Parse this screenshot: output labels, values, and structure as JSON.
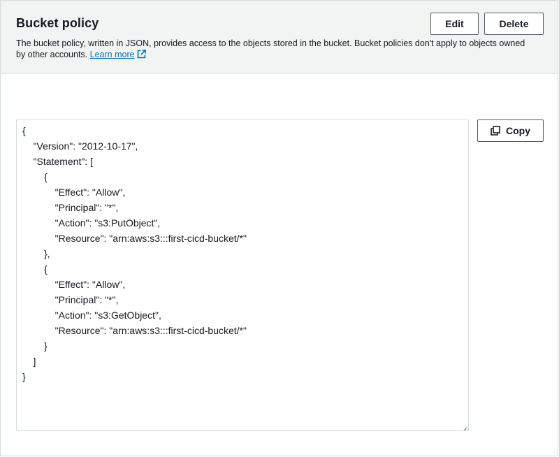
{
  "header": {
    "title": "Bucket policy",
    "description": "The bucket policy, written in JSON, provides access to the objects stored in the bucket. Bucket policies don't apply to objects owned by other accounts.",
    "learn_more": "Learn more",
    "edit_label": "Edit",
    "delete_label": "Delete"
  },
  "policy": {
    "lines": [
      "{",
      "    \"Version\": \"2012-10-17\",",
      "    \"Statement\": [",
      "        {",
      "            \"Effect\": \"Allow\",",
      "            \"Principal\": \"*\",",
      "            \"Action\": \"s3:PutObject\",",
      "            \"Resource\": \"arn:aws:s3:::first-cicd-bucket/*\"",
      "        },",
      "        {",
      "            \"Effect\": \"Allow\",",
      "            \"Principal\": \"*\",",
      "            \"Action\": \"s3:GetObject\",",
      "            \"Resource\": \"arn:aws:s3:::first-cicd-bucket/*\"",
      "        }",
      "    ]",
      "}"
    ],
    "copy_label": "Copy"
  },
  "icons": {
    "external_link": "external-link-icon",
    "copy": "copy-icon",
    "resize": "resize-handle-icon"
  },
  "colors": {
    "link": "#0073bb",
    "header_bg": "#f2f3f3",
    "button_border": "#545b64",
    "text": "#16191f"
  }
}
